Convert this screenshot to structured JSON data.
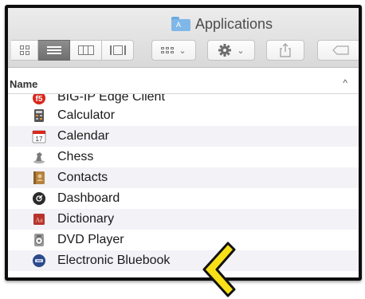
{
  "window": {
    "title": "Applications"
  },
  "header": {
    "name_column": "Name",
    "sort_indicator": "^"
  },
  "files": [
    {
      "name": "BIG-IP Edge Client",
      "icon": "f5-icon",
      "color": "#d9261c"
    },
    {
      "name": "Calculator",
      "icon": "calculator-icon",
      "color": "#555555"
    },
    {
      "name": "Calendar",
      "icon": "calendar-icon",
      "color": "#d9261c"
    },
    {
      "name": "Chess",
      "icon": "chess-icon",
      "color": "#8a8a8a"
    },
    {
      "name": "Contacts",
      "icon": "contacts-icon",
      "color": "#b5833f"
    },
    {
      "name": "Dashboard",
      "icon": "dashboard-icon",
      "color": "#2a2a2a"
    },
    {
      "name": "Dictionary",
      "icon": "dictionary-icon",
      "color": "#b8332e"
    },
    {
      "name": "DVD Player",
      "icon": "dvd-player-icon",
      "color": "#7c7c7c"
    },
    {
      "name": "Electronic Bluebook",
      "icon": "bluebook-icon",
      "color": "#2c4a8c"
    }
  ],
  "highlight_arrow_color": "#f7e017"
}
